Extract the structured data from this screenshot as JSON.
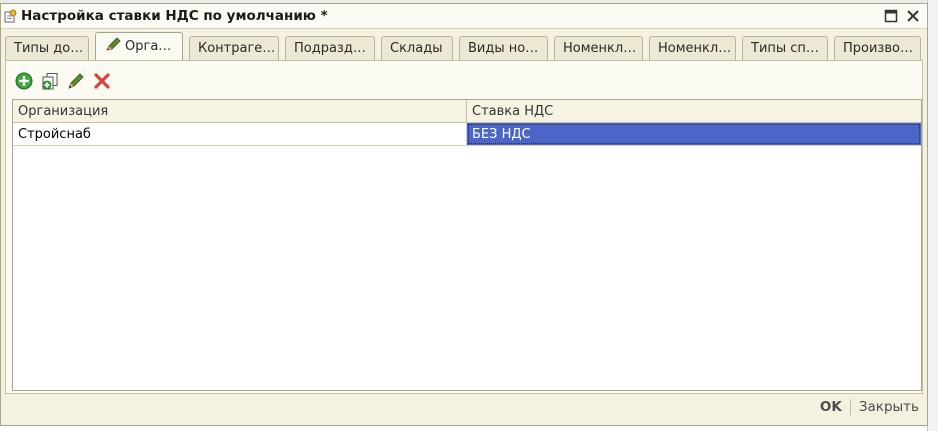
{
  "window": {
    "title": "Настройка ставки НДС по умолчанию *",
    "icons": {
      "title": "document-gear-icon",
      "maximize": "maximize-icon",
      "close": "close-icon"
    }
  },
  "tabs": [
    {
      "label": "Типы до…",
      "active": false
    },
    {
      "label": "Орга…",
      "active": true,
      "icon": "pencil-icon"
    },
    {
      "label": "Контраге…",
      "active": false
    },
    {
      "label": "Подразд…",
      "active": false
    },
    {
      "label": "Склады",
      "active": false
    },
    {
      "label": "Виды но…",
      "active": false
    },
    {
      "label": "Номенкл…",
      "active": false
    },
    {
      "label": "Номенкл…",
      "active": false
    },
    {
      "label": "Типы сп…",
      "active": false
    },
    {
      "label": "Произво…",
      "active": false
    }
  ],
  "toolbar": {
    "buttons": [
      "add-icon",
      "copy-icon",
      "edit-icon",
      "delete-icon"
    ]
  },
  "table": {
    "columns": [
      "Организация",
      "Ставка НДС"
    ],
    "rows": [
      {
        "organization": "Стройснаб",
        "vat_rate": "БЕЗ НДС"
      }
    ]
  },
  "footer": {
    "ok_label": "OK",
    "close_label": "Закрыть"
  },
  "colors": {
    "selection": "#4b66c7",
    "window_bg": "#f4f1e0"
  }
}
